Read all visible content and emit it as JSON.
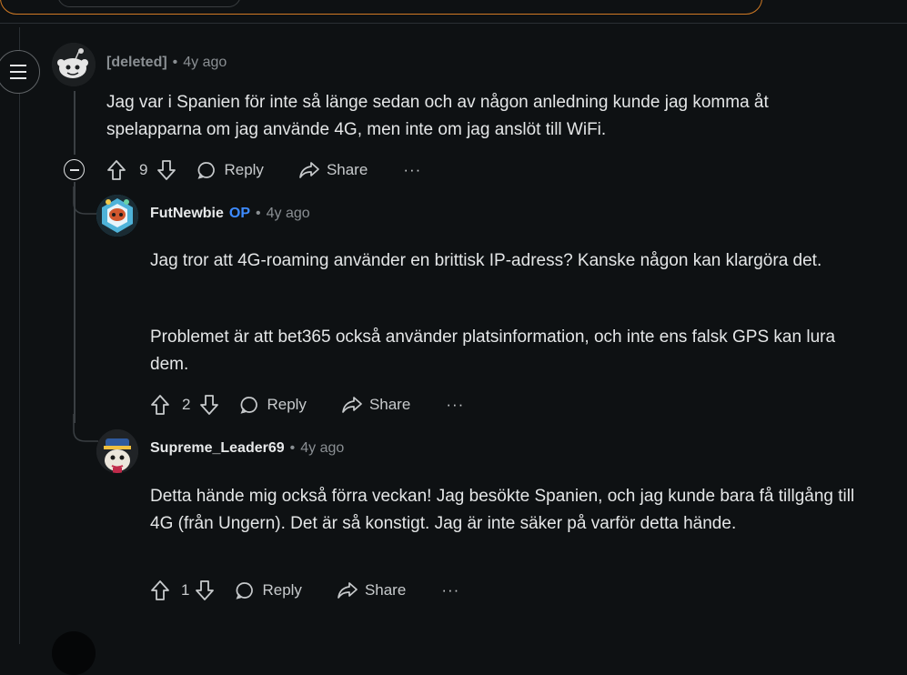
{
  "comments": [
    {
      "author": "[deleted]",
      "op_badge": "",
      "separator": "•",
      "time": "4y ago",
      "body": [
        "Jag var i Spanien för inte så länge sedan och av någon anledning kunde jag komma åt spelapparna om jag använde 4G, men inte om jag anslöt till WiFi."
      ],
      "votes": "9",
      "reply_label": "Reply",
      "share_label": "Share",
      "more_label": "···"
    },
    {
      "author": "FutNewbie",
      "op_badge": "OP",
      "separator": "•",
      "time": "4y ago",
      "body": [
        "Jag tror att 4G-roaming använder en brittisk IP-adress? Kanske någon kan klargöra det.",
        "Problemet är att bet365 också använder platsinformation, och inte ens falsk GPS kan lura dem."
      ],
      "votes": "2",
      "reply_label": "Reply",
      "share_label": "Share",
      "more_label": "···"
    },
    {
      "author": "Supreme_Leader69",
      "op_badge": "",
      "separator": "•",
      "time": "4y ago",
      "body": [
        "Detta hände mig också förra veckan! Jag besökte Spanien, och jag kunde bara få tillgång till 4G (från Ungern). Det är så konstigt. Jag är inte säker på varför detta hände."
      ],
      "votes": "1",
      "reply_label": "Reply",
      "share_label": "Share",
      "more_label": "···"
    }
  ],
  "colors": {
    "accent_border": "#d07a24",
    "op_blue": "#3d8bff",
    "background": "#0e1113"
  },
  "icons": [
    "menu-icon",
    "collapse-icon",
    "upvote-icon",
    "downvote-icon",
    "reply-icon",
    "share-icon",
    "more-icon"
  ]
}
